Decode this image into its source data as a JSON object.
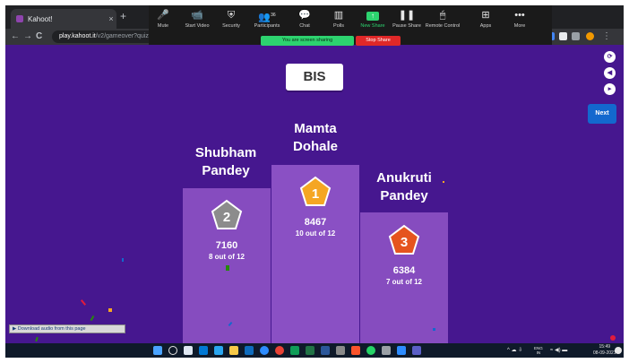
{
  "browser": {
    "tab_title": "Kahoot!",
    "tab_close": "×",
    "new_tab": "+",
    "url_host": "play.kahoot.it",
    "url_path": "/v2/gameover?quizId=...",
    "back_icon": "←",
    "forward_icon": "→",
    "reload_icon": "C",
    "lock_icon": "🔒"
  },
  "zoom": {
    "buttons": [
      {
        "label": "Mute",
        "icon": "mic-icon",
        "glyph": "🎤"
      },
      {
        "label": "Start Video",
        "icon": "video-icon",
        "glyph": "📹"
      },
      {
        "label": "Security",
        "icon": "shield-icon",
        "glyph": "⛨"
      },
      {
        "label": "Participants",
        "icon": "participants-icon",
        "glyph": "👥",
        "count": "36"
      },
      {
        "label": "Chat",
        "icon": "chat-icon",
        "glyph": "💬"
      },
      {
        "label": "Polls",
        "icon": "polls-icon",
        "glyph": "▥"
      },
      {
        "label": "New Share",
        "icon": "share-icon",
        "glyph": "↑"
      },
      {
        "label": "Pause Share",
        "icon": "pause-icon",
        "glyph": "❚❚"
      },
      {
        "label": "Remote Control",
        "icon": "remote-control-icon",
        "glyph": "🖱"
      },
      {
        "label": "Apps",
        "icon": "apps-icon",
        "glyph": "⊞"
      },
      {
        "label": "More",
        "icon": "more-icon",
        "glyph": "•••"
      }
    ],
    "sharing_banner": "You are screen sharing",
    "stop_share": "Stop Share"
  },
  "kahoot": {
    "quiz_title": "BIS",
    "next_label": "Next",
    "podium": [
      {
        "rank": "1",
        "name_line1": "Mamta",
        "name_line2": "Dohale",
        "score": "8467",
        "detail": "10 out of 12"
      },
      {
        "rank": "2",
        "name_line1": "Shubham",
        "name_line2": "Pandey",
        "score": "7160",
        "detail": "8 out of 12"
      },
      {
        "rank": "3",
        "name_line1": "Anukruti",
        "name_line2": "Pandey",
        "score": "6384",
        "detail": "7 out of 12"
      }
    ],
    "badge_colors": {
      "gold": "#f5a623",
      "silver": "#8c8c8c",
      "bronze": "#e5541e"
    },
    "side_icons": [
      "rotate-icon",
      "volume-icon",
      "fullscreen-icon"
    ]
  },
  "download_bar": "Download audio from this page",
  "taskbar": {
    "language": "ENG",
    "region": "IN",
    "time": "15:49",
    "date": "08-09-2021"
  },
  "colors": {
    "kahoot_purple": "#46178f",
    "podium": "#864cbf",
    "next_button": "#1368ce",
    "zoom_green": "#2dd36f",
    "stop_red": "#e02828"
  }
}
